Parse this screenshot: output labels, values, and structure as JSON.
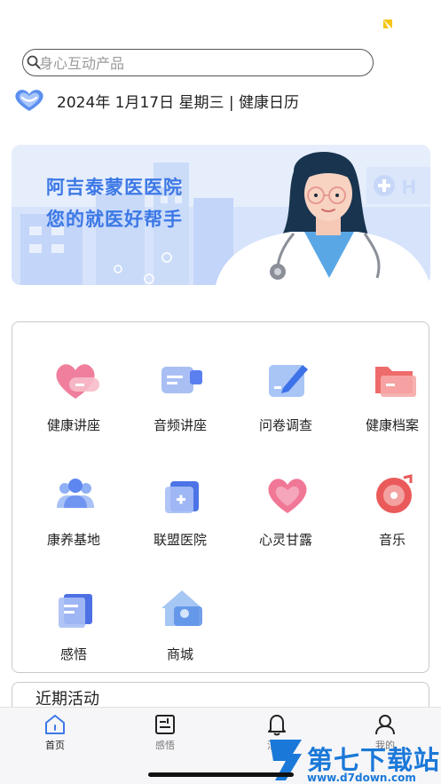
{
  "search": {
    "placeholder": "身心互动产品",
    "icon": "search-icon"
  },
  "date_bar": {
    "text": "2024年 1月17日 星期三 | 健康日历",
    "icon": "heart-calendar-icon"
  },
  "banner": {
    "line1": "阿吉泰蒙医医院",
    "line2": "您的就医好帮手",
    "accent": "#3c78e6"
  },
  "grid": {
    "items": [
      {
        "label": "健康讲座",
        "icon": "heart-pill-icon"
      },
      {
        "label": "音频讲座",
        "icon": "video-camera-icon"
      },
      {
        "label": "问卷调查",
        "icon": "edit-pen-icon"
      },
      {
        "label": "健康档案",
        "icon": "folder-icon"
      },
      {
        "label": "康养基地",
        "icon": "group-people-icon"
      },
      {
        "label": "联盟医院",
        "icon": "hospital-plus-icon"
      },
      {
        "label": "心灵甘露",
        "icon": "heart-icon"
      },
      {
        "label": "音乐",
        "icon": "music-disc-icon"
      },
      {
        "label": "感悟",
        "icon": "book-icon"
      },
      {
        "label": "商城",
        "icon": "house-store-icon"
      }
    ]
  },
  "recent": {
    "title": "近期活动"
  },
  "tabbar": {
    "items": [
      {
        "label": "首页",
        "icon": "home-icon",
        "active": true
      },
      {
        "label": "感悟",
        "icon": "notebook-icon",
        "active": false
      },
      {
        "label": "消息",
        "icon": "bell-icon",
        "active": false
      },
      {
        "label": "我的",
        "icon": "user-icon",
        "active": false
      }
    ]
  },
  "watermark": {
    "title": "第七下载站",
    "url": "www.d7down.com"
  },
  "colors": {
    "brand_blue": "#3c78e6",
    "watermark_blue": "#1a78d8",
    "status_mark": "#f5c518"
  }
}
